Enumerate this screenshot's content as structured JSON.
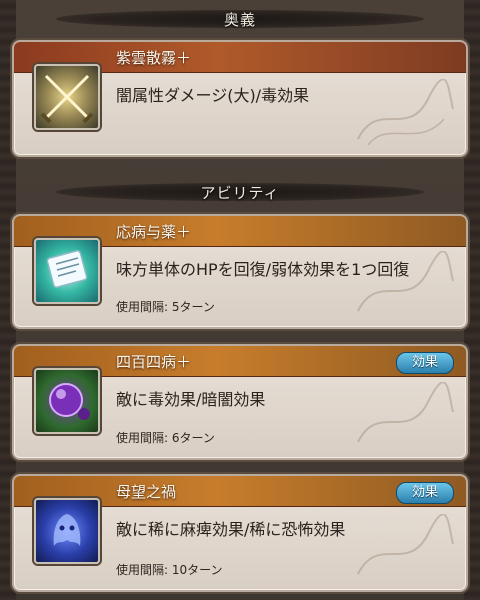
{
  "sections": {
    "ougi": "奥義",
    "ability": "アビリティ"
  },
  "ougi": {
    "name": "紫雲散霧＋",
    "description": "闇属性ダメージ(大)/毒効果",
    "icon": "crossed-swords-icon"
  },
  "abilities": [
    {
      "name": "応病与薬＋",
      "description": "味方単体のHPを回復/弱体効果を1つ回復",
      "cooldown": "使用間隔: 5ターン",
      "icon": "scroll-icon",
      "effect_button": ""
    },
    {
      "name": "四百四病＋",
      "description": "敵に毒効果/暗闇効果",
      "cooldown": "使用間隔: 6ターン",
      "icon": "poison-orb-icon",
      "effect_button": "効果"
    },
    {
      "name": "母望之禍",
      "description": "敵に稀に麻痺効果/稀に恐怖効果",
      "cooldown": "使用間隔: 10ターン",
      "icon": "blue-phantom-icon",
      "effect_button": "効果"
    }
  ],
  "colors": {
    "ougi_band": "#9c4322",
    "ability_band": "#b06e27",
    "effect_button": "#3a95c4"
  }
}
